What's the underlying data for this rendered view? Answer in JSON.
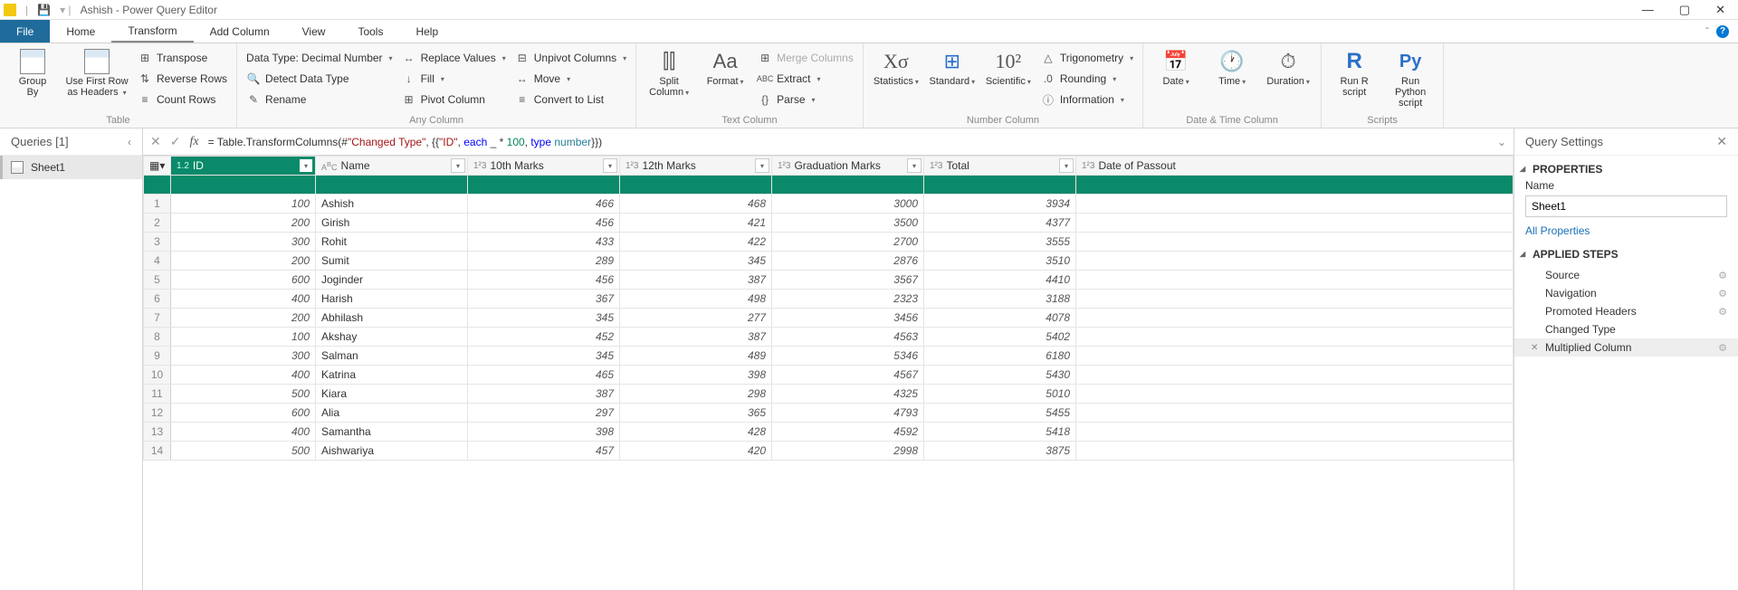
{
  "titlebar": {
    "title": "Ashish - Power Query Editor"
  },
  "tabs": {
    "file": "File",
    "home": "Home",
    "transform": "Transform",
    "addcolumn": "Add Column",
    "view": "View",
    "tools": "Tools",
    "help": "Help"
  },
  "ribbon": {
    "table": {
      "groupby": "Group\nBy",
      "usefirst": "Use First Row\nas Headers",
      "transpose": "Transpose",
      "reverse": "Reverse Rows",
      "count": "Count Rows",
      "label": "Table"
    },
    "anycol": {
      "datatype": "Data Type: Decimal Number",
      "detect": "Detect Data Type",
      "rename": "Rename",
      "replace": "Replace Values",
      "fill": "Fill",
      "pivot": "Pivot Column",
      "unpivot": "Unpivot Columns",
      "move": "Move",
      "convert": "Convert to List",
      "label": "Any Column"
    },
    "textcol": {
      "split": "Split\nColumn",
      "format": "Format",
      "merge": "Merge Columns",
      "extract": "Extract",
      "parse": "Parse",
      "label": "Text Column"
    },
    "numcol": {
      "stats": "Statistics",
      "standard": "Standard",
      "scientific": "Scientific",
      "trig": "Trigonometry",
      "rounding": "Rounding",
      "info": "Information",
      "label": "Number Column"
    },
    "datetime": {
      "date": "Date",
      "time": "Time",
      "duration": "Duration",
      "label": "Date & Time Column"
    },
    "scripts": {
      "r": "Run R\nscript",
      "py": "Run Python\nscript",
      "label": "Scripts"
    }
  },
  "queries": {
    "header": "Queries [1]",
    "item": "Sheet1"
  },
  "formula": {
    "prefix": "= Table.TransformColumns(#",
    "s1": "\"Changed Type\"",
    "mid1": ", {{",
    "s2": "\"ID\"",
    "mid2": ", ",
    "kw1": "each",
    "mid3": " _ * ",
    "num1": "100",
    "mid4": ", ",
    "kw2": "type",
    "typ1": " number",
    "suffix": "}})"
  },
  "columns": [
    "ID",
    "Name",
    "10th Marks",
    "12th Marks",
    "Graduation Marks",
    "Total",
    "Date of Passout"
  ],
  "coltypes": [
    "1.2",
    "ABC",
    "123",
    "123",
    "123",
    "123",
    "123"
  ],
  "rows": [
    {
      "n": 1,
      "id": 100,
      "name": "Ashish",
      "m10": 466,
      "m12": 468,
      "grad": 3000,
      "total": 3934
    },
    {
      "n": 2,
      "id": 200,
      "name": "Girish",
      "m10": 456,
      "m12": 421,
      "grad": 3500,
      "total": 4377
    },
    {
      "n": 3,
      "id": 300,
      "name": "Rohit",
      "m10": 433,
      "m12": 422,
      "grad": 2700,
      "total": 3555
    },
    {
      "n": 4,
      "id": 200,
      "name": "Sumit",
      "m10": 289,
      "m12": 345,
      "grad": 2876,
      "total": 3510
    },
    {
      "n": 5,
      "id": 600,
      "name": "Joginder",
      "m10": 456,
      "m12": 387,
      "grad": 3567,
      "total": 4410
    },
    {
      "n": 6,
      "id": 400,
      "name": "Harish",
      "m10": 367,
      "m12": 498,
      "grad": 2323,
      "total": 3188
    },
    {
      "n": 7,
      "id": 200,
      "name": "Abhilash",
      "m10": 345,
      "m12": 277,
      "grad": 3456,
      "total": 4078
    },
    {
      "n": 8,
      "id": 100,
      "name": "Akshay",
      "m10": 452,
      "m12": 387,
      "grad": 4563,
      "total": 5402
    },
    {
      "n": 9,
      "id": 300,
      "name": "Salman",
      "m10": 345,
      "m12": 489,
      "grad": 5346,
      "total": 6180
    },
    {
      "n": 10,
      "id": 400,
      "name": "Katrina",
      "m10": 465,
      "m12": 398,
      "grad": 4567,
      "total": 5430
    },
    {
      "n": 11,
      "id": 500,
      "name": "Kiara",
      "m10": 387,
      "m12": 298,
      "grad": 4325,
      "total": 5010
    },
    {
      "n": 12,
      "id": 600,
      "name": "Alia",
      "m10": 297,
      "m12": 365,
      "grad": 4793,
      "total": 5455
    },
    {
      "n": 13,
      "id": 400,
      "name": "Samantha",
      "m10": 398,
      "m12": 428,
      "grad": 4592,
      "total": 5418
    },
    {
      "n": 14,
      "id": 500,
      "name": "Aishwariya",
      "m10": 457,
      "m12": 420,
      "grad": 2998,
      "total": 3875
    }
  ],
  "settings": {
    "header": "Query Settings",
    "properties": "PROPERTIES",
    "namelabel": "Name",
    "namevalue": "Sheet1",
    "allprops": "All Properties",
    "steps_header": "APPLIED STEPS",
    "steps": [
      "Source",
      "Navigation",
      "Promoted Headers",
      "Changed Type",
      "Multiplied Column"
    ]
  }
}
